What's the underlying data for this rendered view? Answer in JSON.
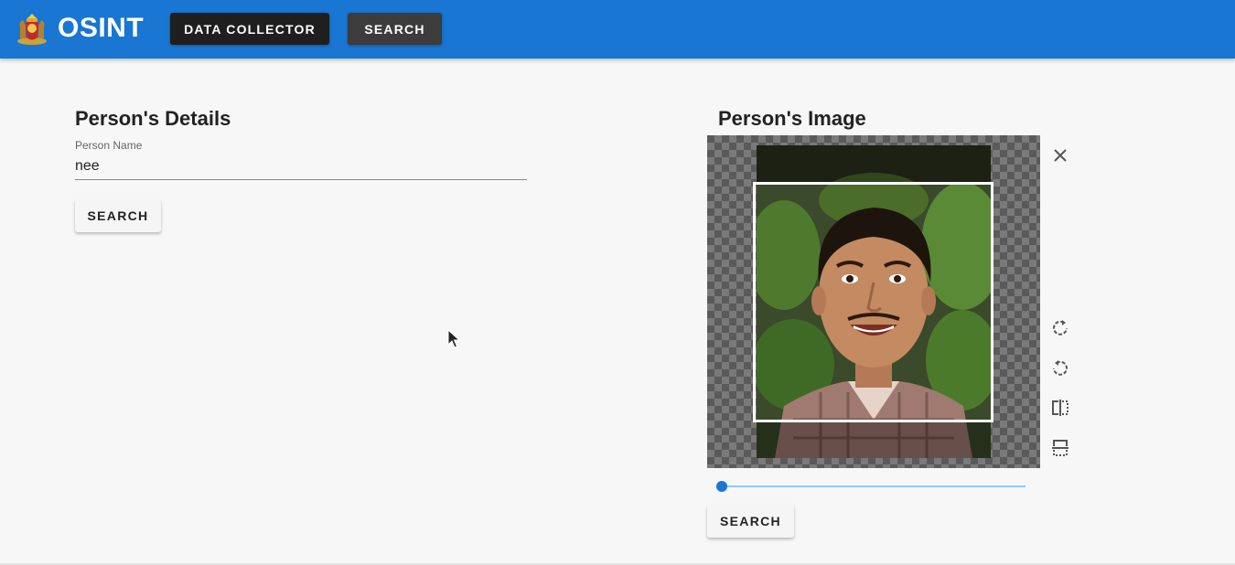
{
  "header": {
    "app_title": "OSINT",
    "logo_icon": "state-emblem-logo",
    "nav": [
      {
        "label": "DATA COLLECTOR"
      },
      {
        "label": "SEARCH"
      }
    ],
    "colors": {
      "bar": "#1976d2",
      "active_button": "#1f1f1f",
      "button": "#3c3c3c"
    }
  },
  "details": {
    "title": "Person's Details",
    "name_label": "Person Name",
    "name_value": "nee",
    "search_label": "SEARCH"
  },
  "image_panel": {
    "title": "Person's Image",
    "tools": [
      "close-icon",
      "rotate-right-icon",
      "rotate-left-icon",
      "flip-horizontal-icon",
      "flip-vertical-icon"
    ],
    "zoom": 0,
    "search_label": "SEARCH"
  }
}
